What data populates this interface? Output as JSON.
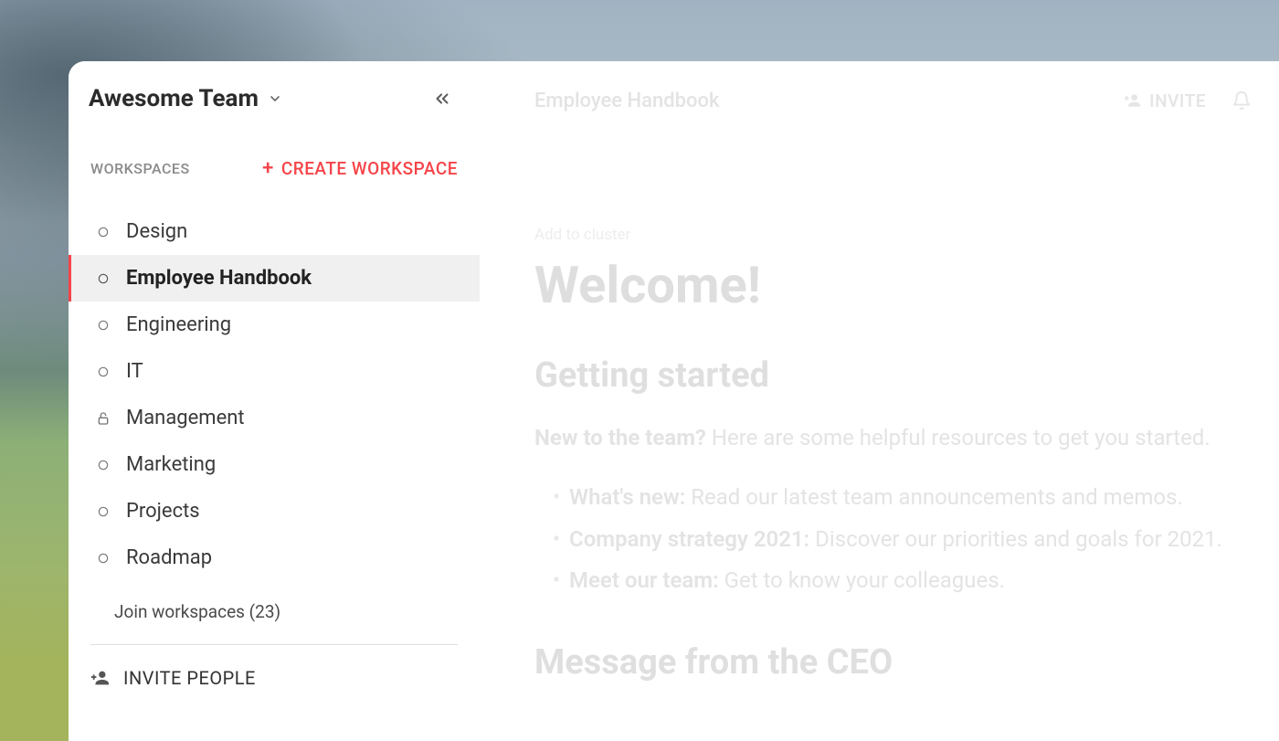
{
  "team": {
    "name": "Awesome Team"
  },
  "sidebar": {
    "workspaces_label": "WORKSPACES",
    "create_label": "CREATE WORKSPACE",
    "items": [
      {
        "label": "Design",
        "icon": "circle",
        "active": false
      },
      {
        "label": "Employee Handbook",
        "icon": "circle",
        "active": true
      },
      {
        "label": "Engineering",
        "icon": "circle",
        "active": false
      },
      {
        "label": "IT",
        "icon": "circle",
        "active": false
      },
      {
        "label": "Management",
        "icon": "lock",
        "active": false
      },
      {
        "label": "Marketing",
        "icon": "circle",
        "active": false
      },
      {
        "label": "Projects",
        "icon": "circle",
        "active": false
      },
      {
        "label": "Roadmap",
        "icon": "circle",
        "active": false
      }
    ],
    "join_workspaces": {
      "text": "Join workspaces (23)",
      "count": 23
    },
    "invite_people_label": "INVITE PEOPLE"
  },
  "topbar": {
    "breadcrumb": "Employee Handbook",
    "invite_label": "INVITE"
  },
  "document": {
    "add_to_cluster": "Add to cluster",
    "title": "Welcome!",
    "section1_heading": "Getting started",
    "intro_bold": "New to the team?",
    "intro_rest": " Here are some helpful resources to get you started.",
    "bullets": [
      {
        "lead": "What's new:",
        "rest": " Read our latest team announcements and memos."
      },
      {
        "lead": "Company strategy 2021:",
        "rest": " Discover our priorities and goals for 2021."
      },
      {
        "lead": "Meet our team:",
        "rest": " Get to know your colleagues."
      }
    ],
    "section2_heading": "Message from the CEO"
  }
}
